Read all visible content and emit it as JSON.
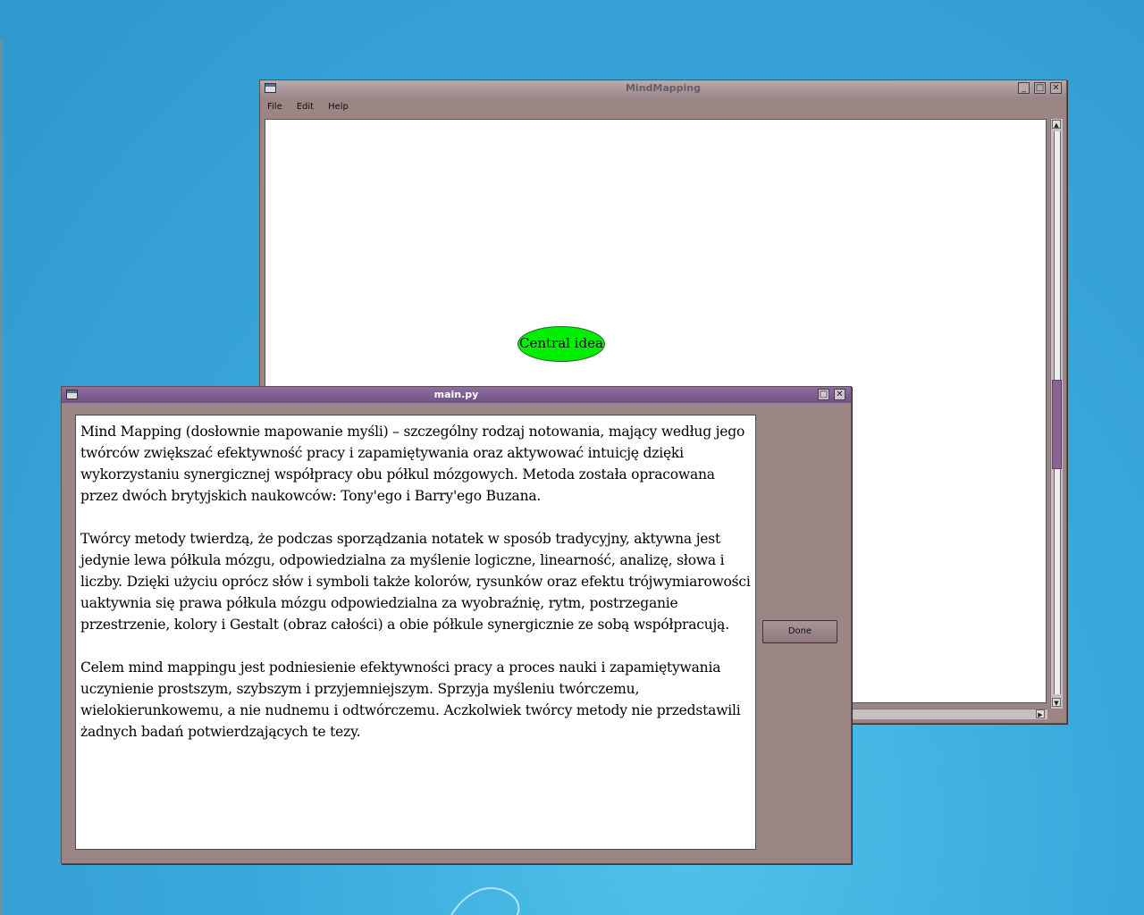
{
  "mindmap_window": {
    "title": "MindMapping",
    "menu": [
      "File",
      "Edit",
      "Help"
    ],
    "node_label": "Central idea",
    "node_color": "#00ee00"
  },
  "main_window": {
    "title": "main.py",
    "paragraphs": [
      "Mind Mapping (dosłownie mapowanie myśli) – szczególny rodzaj notowania, mający według jego twórców zwiększać efektywność pracy i zapamiętywania oraz aktywować intuicję dzięki wykorzystaniu synergicznej współpracy obu półkul mózgowych. Metoda została opracowana przez dwóch brytyjskich naukowców: Tony'ego i Barry'ego Buzana.",
      "Twórcy metody twierdzą, że podczas sporządzania notatek w sposób tradycyjny, aktywna jest jedynie lewa półkula mózgu, odpowiedzialna za myślenie logiczne, linearność, analizę, słowa i liczby. Dzięki użyciu oprócz słów i symboli także kolorów, rysunków oraz efektu trójwymiarowości uaktywnia się prawa półkula mózgu odpowiedzialna za wyobraźnię, rytm, postrzeganie przestrzenie, kolory i Gestalt (obraz całości) a obie półkule synergicznie ze sobą współpracują.",
      "Celem mind mappingu jest podniesienie efektywności pracy a proces nauki i zapamiętywania uczynienie prostszym, szybszym i przyjemniejszym. Sprzyja myśleniu twórczemu, wielokierunkowemu, a nie nudnemu i odtwórczemu. Aczkolwiek twórcy metody nie przedstawili żadnych badań potwierdzających te tezy."
    ],
    "done_label": "Done"
  }
}
